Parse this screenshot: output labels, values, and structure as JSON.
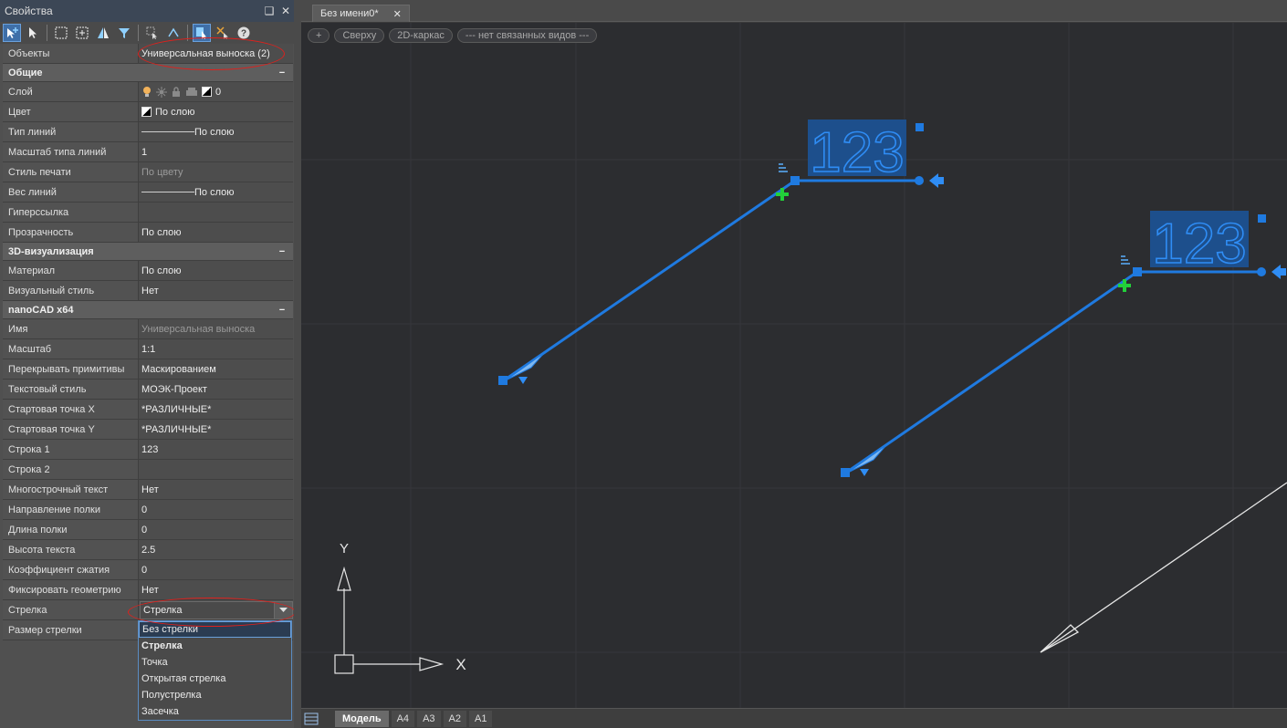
{
  "panel": {
    "title": "Свойства",
    "pin_glyph": "❑",
    "close_glyph": "✕"
  },
  "objects": {
    "label": "Объекты",
    "value": "Универсальная выноска (2)"
  },
  "general": {
    "title": "Общие",
    "collapse_glyph": "−",
    "layer": {
      "label": "Слой",
      "value": "0"
    },
    "color": {
      "label": "Цвет",
      "value": "По слою"
    },
    "linetype": {
      "label": "Тип линий",
      "value": "По слою"
    },
    "linescale": {
      "label": "Масштаб типа линий",
      "value": "1"
    },
    "plotstyle": {
      "label": "Стиль печати",
      "value": "По цвету"
    },
    "lineweight": {
      "label": "Вес линий",
      "value": "По слою"
    },
    "hyperlink": {
      "label": "Гиперссылка",
      "value": ""
    },
    "transparency": {
      "label": "Прозрачность",
      "value": "По слою"
    }
  },
  "viz3d": {
    "title": "3D-визуализация",
    "collapse_glyph": "−",
    "material": {
      "label": "Материал",
      "value": "По слою"
    },
    "visualstyle": {
      "label": "Визуальный стиль",
      "value": "Нет"
    }
  },
  "nano": {
    "title": "nanoCAD x64",
    "collapse_glyph": "−",
    "name": {
      "label": "Имя",
      "value": "Универсальная выноска"
    },
    "scale": {
      "label": "Масштаб",
      "value": "1:1"
    },
    "overlap": {
      "label": "Перекрывать примитивы",
      "value": "Маскированием"
    },
    "textstyle": {
      "label": "Текстовый стиль",
      "value": "МОЭК-Проект"
    },
    "startx": {
      "label": "Стартовая точка X",
      "value": "*РАЗЛИЧНЫЕ*"
    },
    "starty": {
      "label": "Стартовая точка Y",
      "value": "*РАЗЛИЧНЫЕ*"
    },
    "line1": {
      "label": "Строка 1",
      "value": "123"
    },
    "line2": {
      "label": "Строка 2",
      "value": ""
    },
    "multiline": {
      "label": "Многострочный текст",
      "value": "Нет"
    },
    "shelfdir": {
      "label": "Направление полки",
      "value": "0"
    },
    "shelflen": {
      "label": "Длина полки",
      "value": "0"
    },
    "textheight": {
      "label": "Высота текста",
      "value": "2.5"
    },
    "compress": {
      "label": "Коэффициент сжатия",
      "value": "0"
    },
    "fixgeom": {
      "label": "Фиксировать геометрию",
      "value": "Нет"
    },
    "arrow": {
      "label": "Стрелка",
      "value": "Стрелка"
    },
    "arrowsize": {
      "label": "Размер стрелки"
    }
  },
  "arrow_options": [
    "Без стрелки",
    "Стрелка",
    "Точка",
    "Открытая стрелка",
    "Полустрелка",
    "Засечка"
  ],
  "doc": {
    "tab_title": "Без имени0*",
    "close_glyph": "✕"
  },
  "view_controls": {
    "plus": "+",
    "view": "Сверху",
    "style": "2D-каркас",
    "linked": "--- нет связанных видов ---"
  },
  "leader": {
    "text": "123"
  },
  "ucs": {
    "y": "Y",
    "x": "X"
  },
  "layouts": [
    "Модель",
    "A4",
    "A3",
    "A2",
    "A1"
  ],
  "colors": {
    "accent": "#1f7ae0",
    "selection_fill": "#1d4f8c",
    "annotation": "#e0201c",
    "grip_green": "#22d03a"
  }
}
